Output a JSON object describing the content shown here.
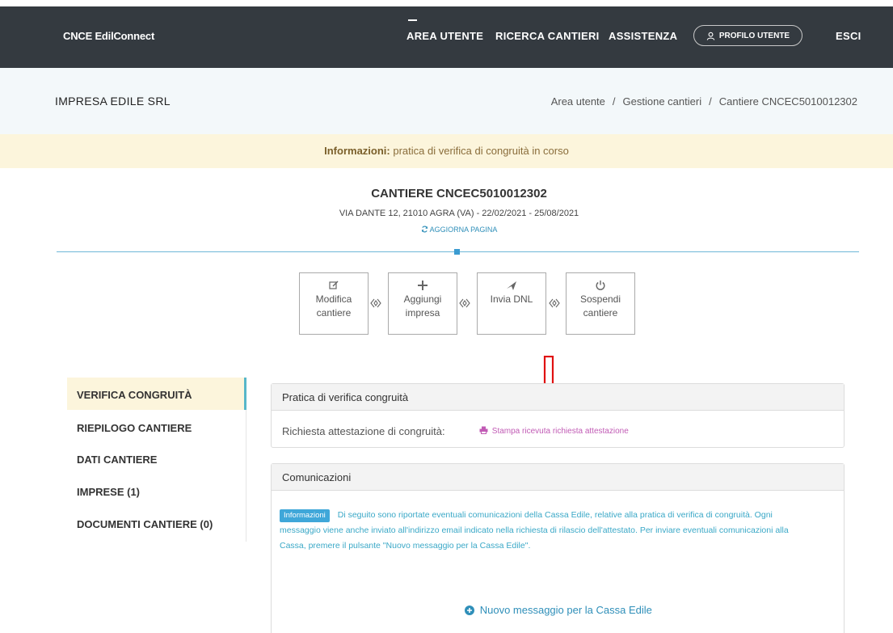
{
  "app": {
    "brand": "CNCE EdilConnect"
  },
  "nav": {
    "area_utente": "AREA UTENTE",
    "ricerca_cantieri": "RICERCA CANTIERI",
    "assistenza": "ASSISTENZA",
    "profilo_utente": "PROFILO UTENTE",
    "esci": "ESCI"
  },
  "company": {
    "name": "IMPRESA EDILE SRL"
  },
  "breadcrumb": [
    "Area utente",
    "Gestione cantieri",
    "Cantiere CNCEC5010012302"
  ],
  "info_banner": {
    "label": "Informazioni:",
    "text": "pratica di verifica di congruità in corso"
  },
  "site": {
    "title": "CANTIERE CNCEC5010012302",
    "subtitle": "VIA DANTE 12, 21010 AGRA (VA) - 22/02/2021 - 25/08/2021",
    "refresh": "AGGIORNA PAGINA"
  },
  "actions": {
    "modifica": [
      "Modifica",
      "cantiere"
    ],
    "aggiungi": [
      "Aggiungi",
      "impresa"
    ],
    "invia": [
      "Invia DNL"
    ],
    "sospendi": [
      "Sospendi",
      "cantiere"
    ]
  },
  "sidebar": {
    "items": [
      "VERIFICA CONGRUITÀ",
      "RIEPILOGO CANTIERE",
      "DATI CANTIERE",
      "IMPRESE (1)",
      "DOCUMENTI CANTIERE (0)"
    ]
  },
  "pratica_panel": {
    "title": "Pratica di verifica congruità",
    "row_label": "Richiesta attestazione di congruità:",
    "print_link": "Stampa ricevuta richiesta attestazione"
  },
  "comunicazioni_panel": {
    "title": "Comunicazioni",
    "badge": "Informazioni",
    "line1": "Di seguito sono riportate eventuali comunicazioni della Cassa Edile, relative alla pratica di verifica di congruità. Ogni",
    "line2": "messaggio viene anche inviato all'indirizzo email indicato nella richiesta di rilascio dell'attestato. Per inviare eventuali comunicazioni alla",
    "line3": "Cassa, premere il pulsante \"Nuovo messaggio per la Cassa Edile\".",
    "new_message": "Nuovo messaggio per la Cassa Edile"
  },
  "colors": {
    "topbar": "#343a40",
    "info_bg": "#fcf5dc",
    "accent_blue": "#2f8fb9",
    "print_link": "#c15bb5",
    "arrow": "#e01010"
  }
}
